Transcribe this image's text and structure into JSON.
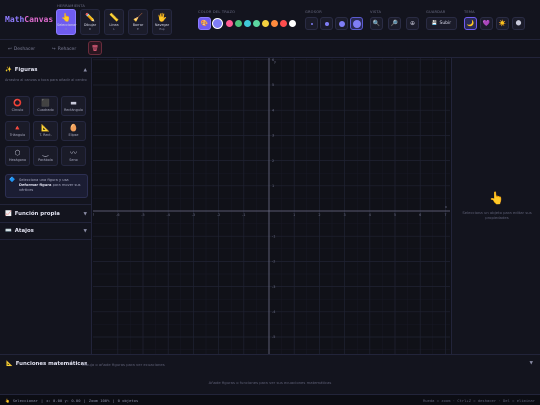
{
  "app": {
    "logo_a": "Math",
    "logo_b": "Canvas"
  },
  "toolbar": {
    "groups": {
      "tools": "Herramienta",
      "colors": "Color del trazo",
      "stroke": "Grosor",
      "view": "Vista",
      "export": "Guardar",
      "theme": "Tema"
    },
    "tools": [
      {
        "icon": "👆",
        "label": "Seleccionar",
        "key": "V"
      },
      {
        "icon": "✏️",
        "label": "Dibujar",
        "key": "D"
      },
      {
        "icon": "📏",
        "label": "Línea",
        "key": "L"
      },
      {
        "icon": "🧹",
        "label": "Borrar",
        "key": "E"
      },
      {
        "icon": "🖐",
        "label": "Navegar",
        "key": "Esp"
      }
    ],
    "palette_icon": "🎨",
    "colors": [
      "#7f7df5",
      "#ff5c93",
      "#4ec27c",
      "#3fc9d8",
      "#5cd6a0",
      "#f4d03f",
      "#ff8a3d",
      "#ff4d4d",
      "#ffffff"
    ],
    "subir_icon": "💾",
    "subir_label": "Subir",
    "themes": [
      "🌙",
      "💜",
      "☀️",
      "🌑"
    ]
  },
  "history": {
    "undo": "Deshacer",
    "redo": "Rehacer",
    "undo_icon": "↩",
    "redo_icon": "↪",
    "delete_icon": "🗑"
  },
  "sidebar": {
    "figures": {
      "icon": "✨",
      "title": "Figuras",
      "hint": "Arrastra al canvas o toca para añadir al centro"
    },
    "shapes": [
      {
        "icon": "⭕",
        "label": "Círculo"
      },
      {
        "icon": "⬛",
        "label": "Cuadrado"
      },
      {
        "icon": "▬",
        "label": "Rectángulo"
      },
      {
        "icon": "🔺",
        "label": "Triángulo"
      },
      {
        "icon": "📐",
        "label": "T. Rect."
      },
      {
        "icon": "🥚",
        "label": "Elipse"
      },
      {
        "icon": "⬡",
        "label": "Hexágono"
      },
      {
        "icon": "‿",
        "label": "Parábola"
      },
      {
        "icon": "〰",
        "label": "Seno"
      }
    ],
    "info": {
      "icon": "🔷",
      "pre": "Selecciona una figura y usa ",
      "bold": "Deformar figura",
      "post": " para mover sus vértices"
    },
    "custom_fn": {
      "icon": "📈",
      "title": "Función propia"
    },
    "shortcuts": {
      "icon": "⌨️",
      "title": "Atajos"
    }
  },
  "axes": {
    "x_ticks": [
      -7,
      -6,
      -5,
      -4,
      -3,
      -2,
      -1,
      1,
      2,
      3,
      4,
      5,
      6,
      7
    ],
    "y_ticks": [
      6,
      5,
      4,
      3,
      2,
      1,
      -1,
      -2,
      -3,
      -4,
      -5,
      -6
    ],
    "x_label": "x",
    "y_label": "y"
  },
  "right_panel": {
    "icon": "👆",
    "message": "Selecciona un objeto para editar sus propiedades"
  },
  "functions": {
    "icon": "📐",
    "title": "Funciones matemáticas",
    "subtitle": "Dibuja o añade figuras para ver ecuaciones",
    "empty": "Añade figuras o funciones para ver sus ecuaciones matemáticas"
  },
  "status": {
    "icon": "👆",
    "mode": "Seleccionar",
    "coords": "x: 0.00  y: 0.00",
    "zoom": "Zoom 100%",
    "objects": "0 objetos",
    "hint": "Rueda = zoom · Ctrl+Z = deshacer · Del = eliminar"
  }
}
